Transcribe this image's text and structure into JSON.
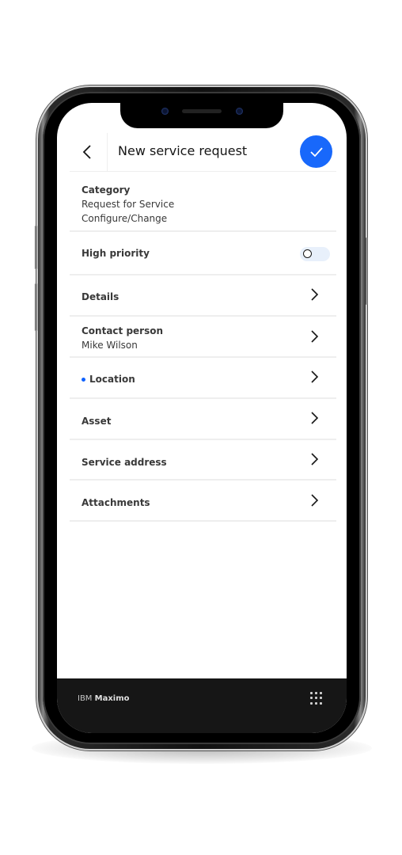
{
  "header": {
    "title": "New service request",
    "back_icon": "chevron-left-icon",
    "confirm_icon": "checkmark-icon"
  },
  "colors": {
    "accent": "#1868fb",
    "indicator_dot": "#0f62fe",
    "footer_bg": "#161616"
  },
  "form": {
    "category": {
      "label": "Category",
      "value_line1": "Request for Service",
      "value_line2": "Configure/Change"
    },
    "high_priority": {
      "label": "High priority",
      "toggle_state": "off"
    },
    "details": {
      "label": "Details"
    },
    "contact_person": {
      "label": "Contact person",
      "value": "Mike Wilson"
    },
    "location": {
      "label": "Location",
      "required_indicator": true
    },
    "asset": {
      "label": "Asset"
    },
    "service_address": {
      "label": "Service address"
    },
    "attachments": {
      "label": "Attachments"
    }
  },
  "footer": {
    "brand_prefix": "IBM",
    "brand_name": "Maximo",
    "menu_icon": "app-switcher-grid-icon"
  }
}
